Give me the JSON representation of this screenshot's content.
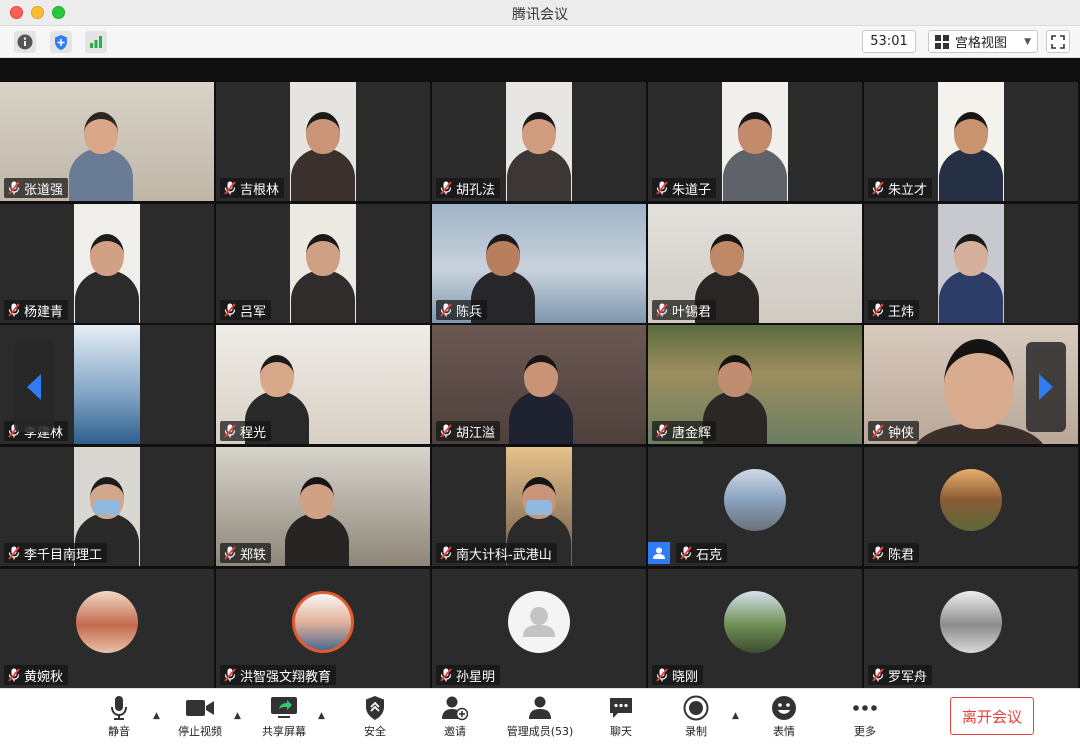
{
  "window": {
    "title": "腾讯会议"
  },
  "toolbar": {
    "timer": "53:01",
    "view_label": "宫格视图",
    "icons": [
      "info-icon",
      "shield-icon",
      "signal-icon",
      "fullscreen-icon"
    ]
  },
  "participants": [
    {
      "name": "张道强"
    },
    {
      "name": "吉根林"
    },
    {
      "name": "胡孔法"
    },
    {
      "name": "朱道子"
    },
    {
      "name": "朱立才"
    },
    {
      "name": "杨建青"
    },
    {
      "name": "吕军"
    },
    {
      "name": "陈兵"
    },
    {
      "name": "叶锡君"
    },
    {
      "name": "王炜"
    },
    {
      "name": "李建林"
    },
    {
      "name": "程光"
    },
    {
      "name": "胡江溢"
    },
    {
      "name": "唐金辉"
    },
    {
      "name": "钟侠"
    },
    {
      "name": "李千目南理工"
    },
    {
      "name": "郑轶"
    },
    {
      "name": "南大计科-武港山"
    },
    {
      "name": "石克"
    },
    {
      "name": "陈君"
    },
    {
      "name": "黄婉秋"
    },
    {
      "name": "洪智强文翔教育"
    },
    {
      "name": "孙星明"
    },
    {
      "name": "晓刚"
    },
    {
      "name": "罗军舟"
    }
  ],
  "controls": {
    "mute": "静音",
    "stop_video": "停止视频",
    "share_screen": "共享屏幕",
    "security": "安全",
    "invite": "邀请",
    "manage_members": "管理成员(53)",
    "chat": "聊天",
    "record": "录制",
    "reactions": "表情",
    "more": "更多",
    "leave": "离开会议"
  },
  "colors": {
    "leave": "#e8413b",
    "muted_mic": "#e8413b",
    "nav_arrow": "#2f7cf6",
    "video_bg": "#2b2b2b"
  }
}
